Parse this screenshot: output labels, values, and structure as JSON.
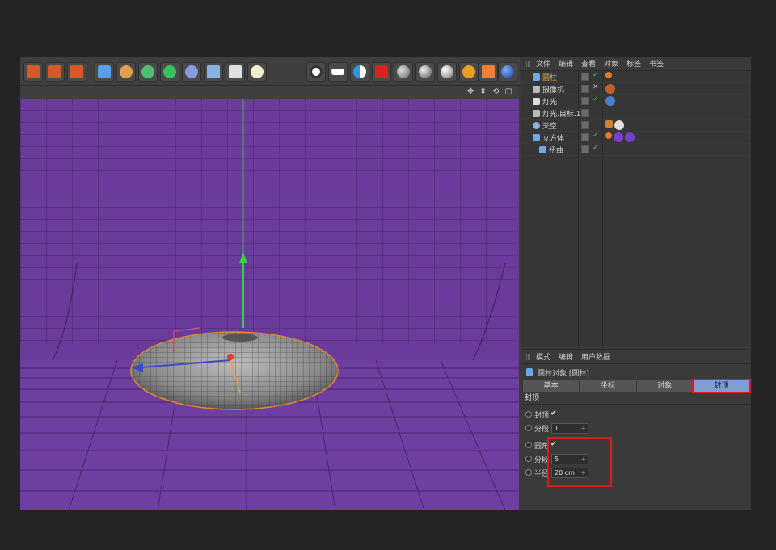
{
  "object_manager": {
    "menu": [
      "文件",
      "编辑",
      "查看",
      "对象",
      "标签",
      "书签"
    ],
    "objects": [
      {
        "name": "圆柱",
        "selected": true,
        "icon_color": "#6fa8e8",
        "tags": [
          "#e07a2a"
        ]
      },
      {
        "name": "摄像机",
        "selected": false,
        "icon_color": "#bbbbbb",
        "tags": [
          "#c0602a"
        ]
      },
      {
        "name": "灯光",
        "selected": false,
        "icon_color": "#dddddd",
        "tags": [
          "#4a7fd0"
        ]
      },
      {
        "name": "灯光.目标.1",
        "selected": false,
        "icon_color": "#bbbbbb",
        "tags": []
      },
      {
        "name": "天空",
        "selected": false,
        "icon_color": "#8fb0d8",
        "tags": [
          "#d08030",
          "#e0e0e0"
        ]
      },
      {
        "name": "立方体",
        "selected": false,
        "icon_color": "#6fa8e8",
        "tags": [
          "#e07a2a",
          "#7b3fd0",
          "#7b3fd0"
        ]
      },
      {
        "name": "扭曲",
        "selected": false,
        "icon_color": "#6fa8e8",
        "tags": []
      }
    ]
  },
  "attribute_manager": {
    "menu": [
      "模式",
      "编辑",
      "用户数据"
    ],
    "title": "圆柱对象 [圆柱]",
    "tabs": [
      "基本",
      "坐标",
      "对象",
      "封顶"
    ],
    "section": "封顶",
    "props": {
      "cap_label": "封顶",
      "cap_check": "✔",
      "segments_label": "分段",
      "segments_value": "1",
      "fillet_label": "圆角",
      "fillet_check": "✔",
      "fillet_segments_label": "分段",
      "fillet_segments_value": "5",
      "radius_label": "半径",
      "radius_value": "20 cm"
    }
  },
  "viewport": {
    "nav_icons": "✥ ⬍ ⟲ ▢"
  }
}
